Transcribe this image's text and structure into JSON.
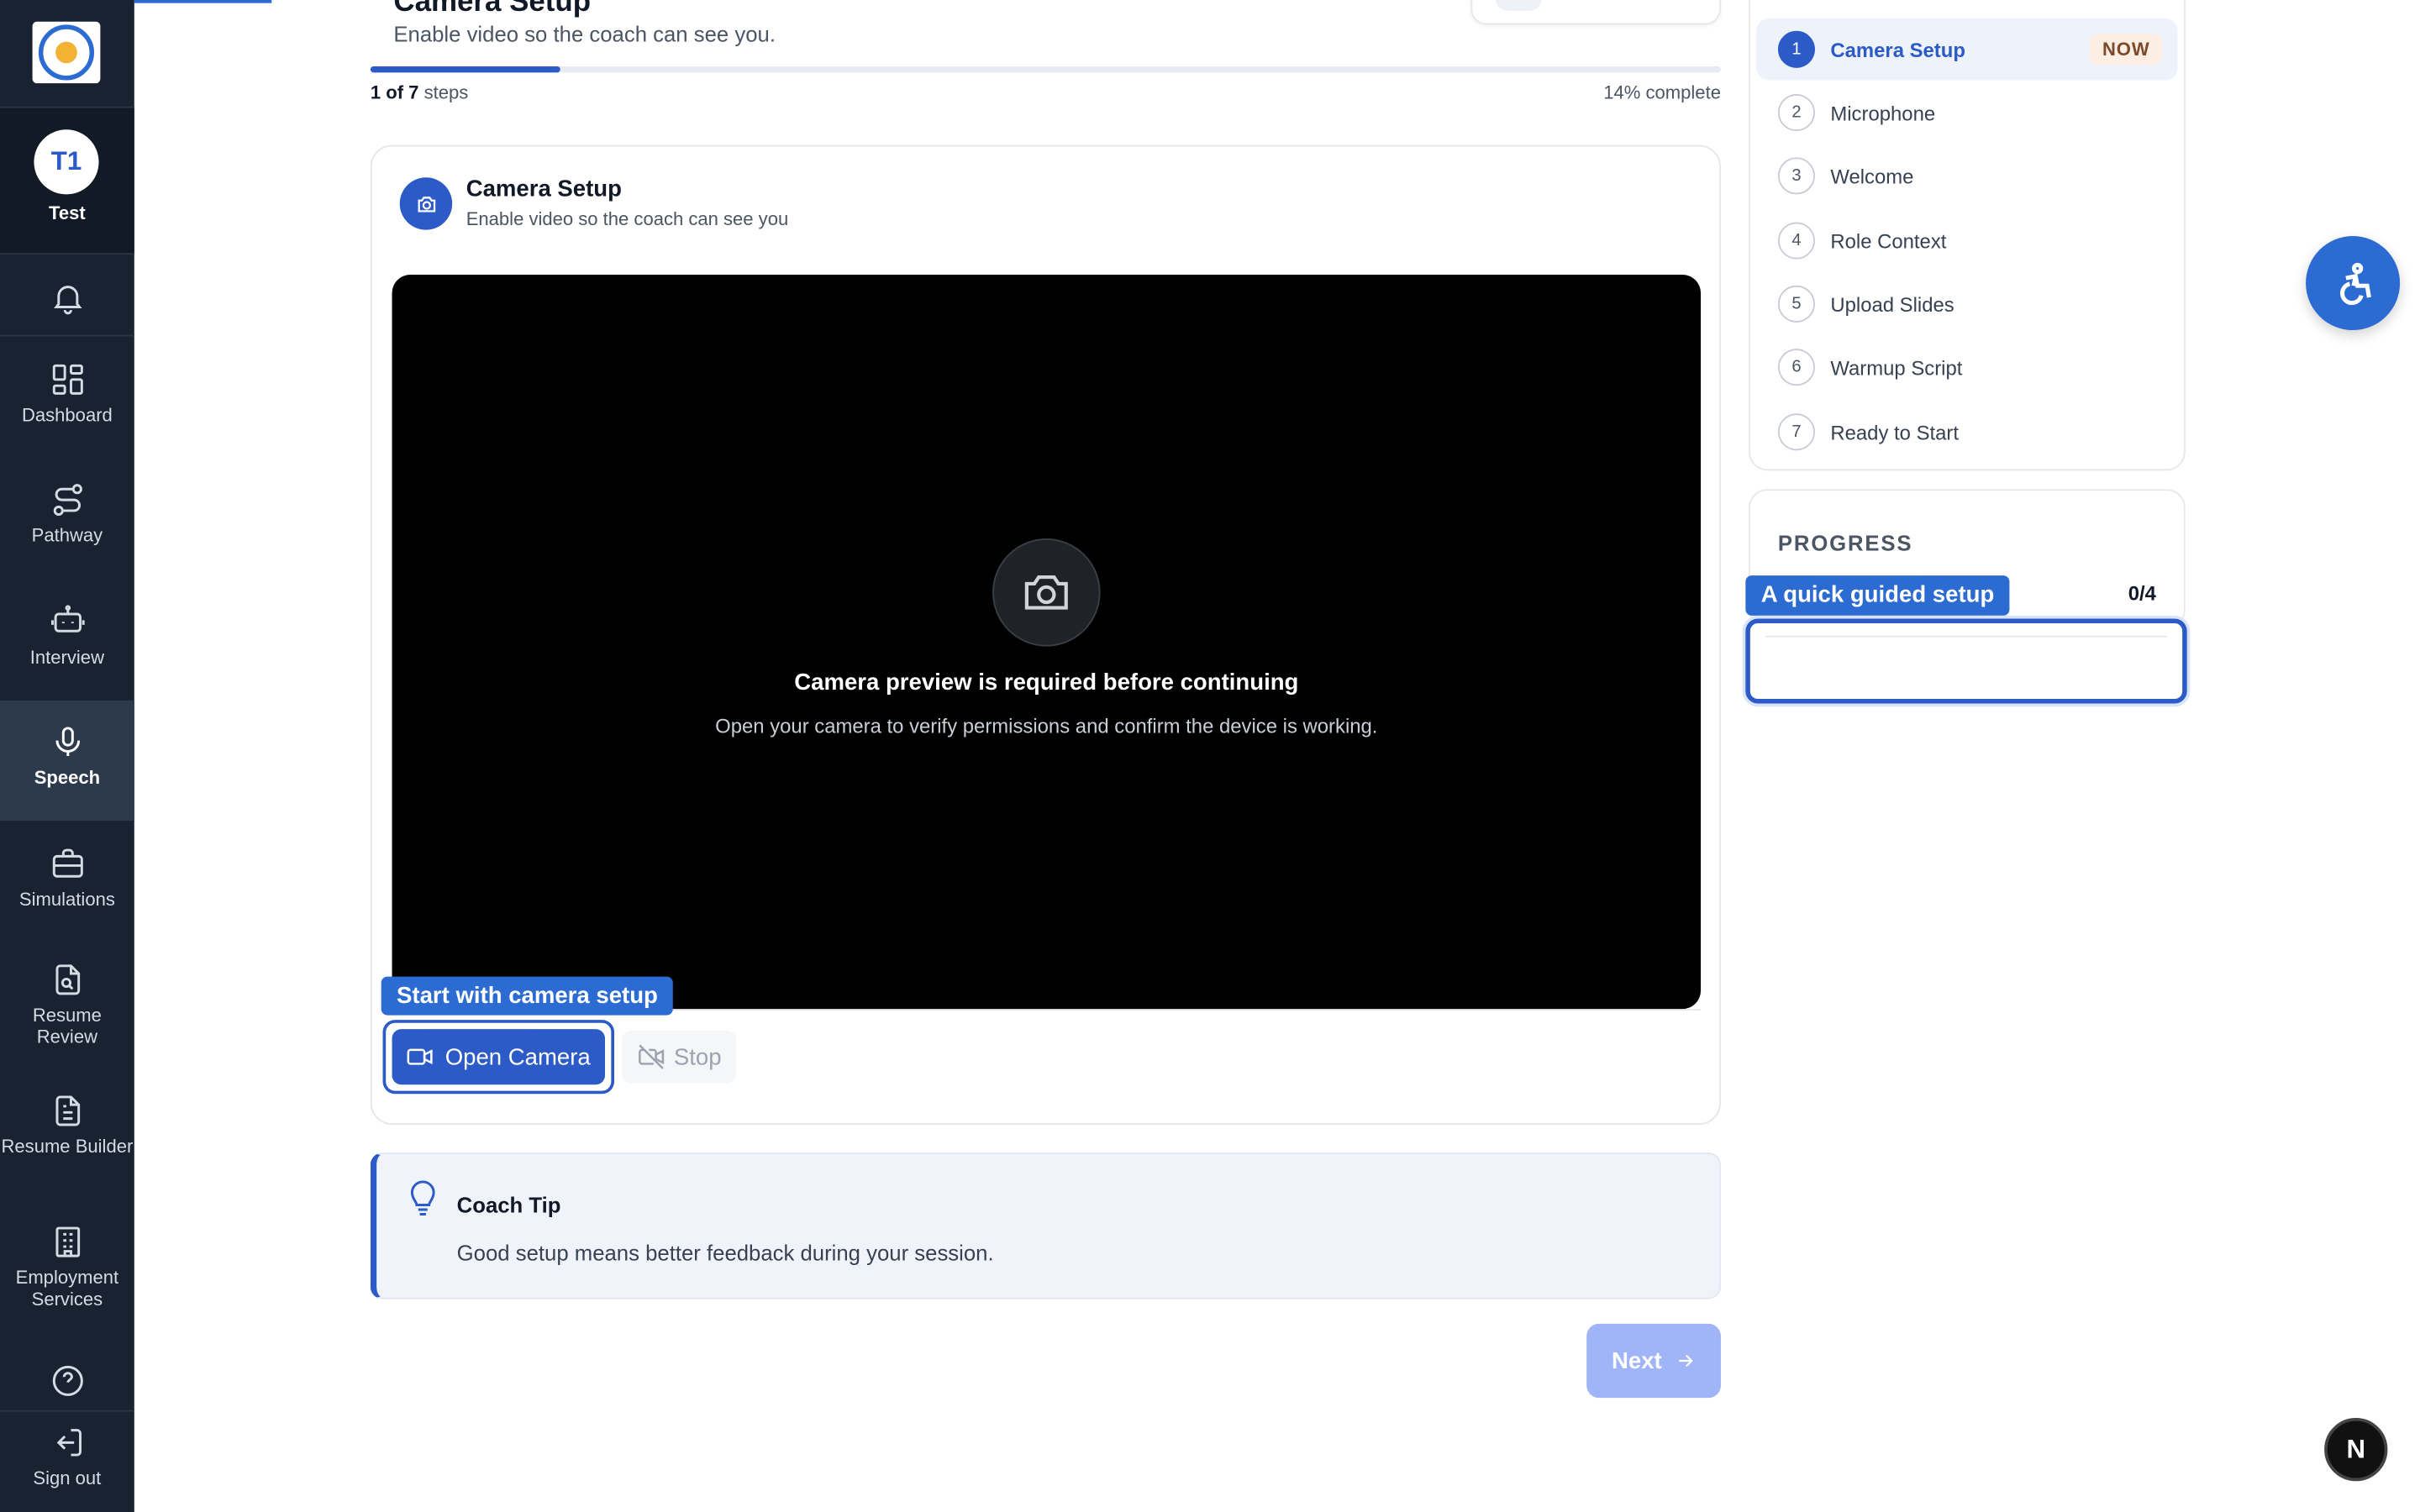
{
  "sidebar": {
    "profile": {
      "initials": "T1",
      "name": "Test"
    },
    "items": [
      {
        "label": "Dashboard",
        "icon": "dashboard-icon"
      },
      {
        "label": "Pathway",
        "icon": "pathway-icon"
      },
      {
        "label": "Interview",
        "icon": "interview-icon"
      },
      {
        "label": "Speech",
        "icon": "microphone-icon",
        "active": true
      },
      {
        "label": "Simulations",
        "icon": "briefcase-icon"
      },
      {
        "label": "Resume Review",
        "icon": "resume-review-icon"
      },
      {
        "label": "Resume Builder",
        "icon": "document-icon"
      },
      {
        "label": "Employment Services",
        "icon": "building-icon"
      }
    ],
    "sign_out": "Sign out"
  },
  "header": {
    "title": "Camera Setup",
    "subtitle": "Enable video so the coach can see you.",
    "progress_fraction": 0.14,
    "current_step": "1",
    "total_steps": "of 7",
    "steps_word": "steps",
    "percent_complete": "14% complete"
  },
  "card": {
    "title": "Camera Setup",
    "subtitle": "Enable video so the coach can see you",
    "preview_title": "Camera preview is required before continuing",
    "preview_subtitle": "Open your camera to verify permissions and confirm the device is working.",
    "tour_tip": "Start with camera setup",
    "open_camera": "Open Camera",
    "stop": "Stop"
  },
  "coach_tip": {
    "title": "Coach Tip",
    "text": "Good setup means better feedback during your session."
  },
  "next_label": "Next",
  "steps": [
    {
      "num": "1",
      "label": "Camera Setup",
      "badge": "NOW"
    },
    {
      "num": "2",
      "label": "Microphone"
    },
    {
      "num": "3",
      "label": "Welcome"
    },
    {
      "num": "4",
      "label": "Role Context"
    },
    {
      "num": "5",
      "label": "Upload Slides"
    },
    {
      "num": "6",
      "label": "Warmup Script"
    },
    {
      "num": "7",
      "label": "Ready to Start"
    }
  ],
  "progress": {
    "title": "PROGRESS",
    "guided_label": "A quick guided setup",
    "count": "0/4"
  },
  "floating": {
    "n_badge": "N"
  },
  "colors": {
    "accent": "#2c5bc8",
    "sidebar_bg": "#182230",
    "next_disabled": "#9fb5f7"
  }
}
